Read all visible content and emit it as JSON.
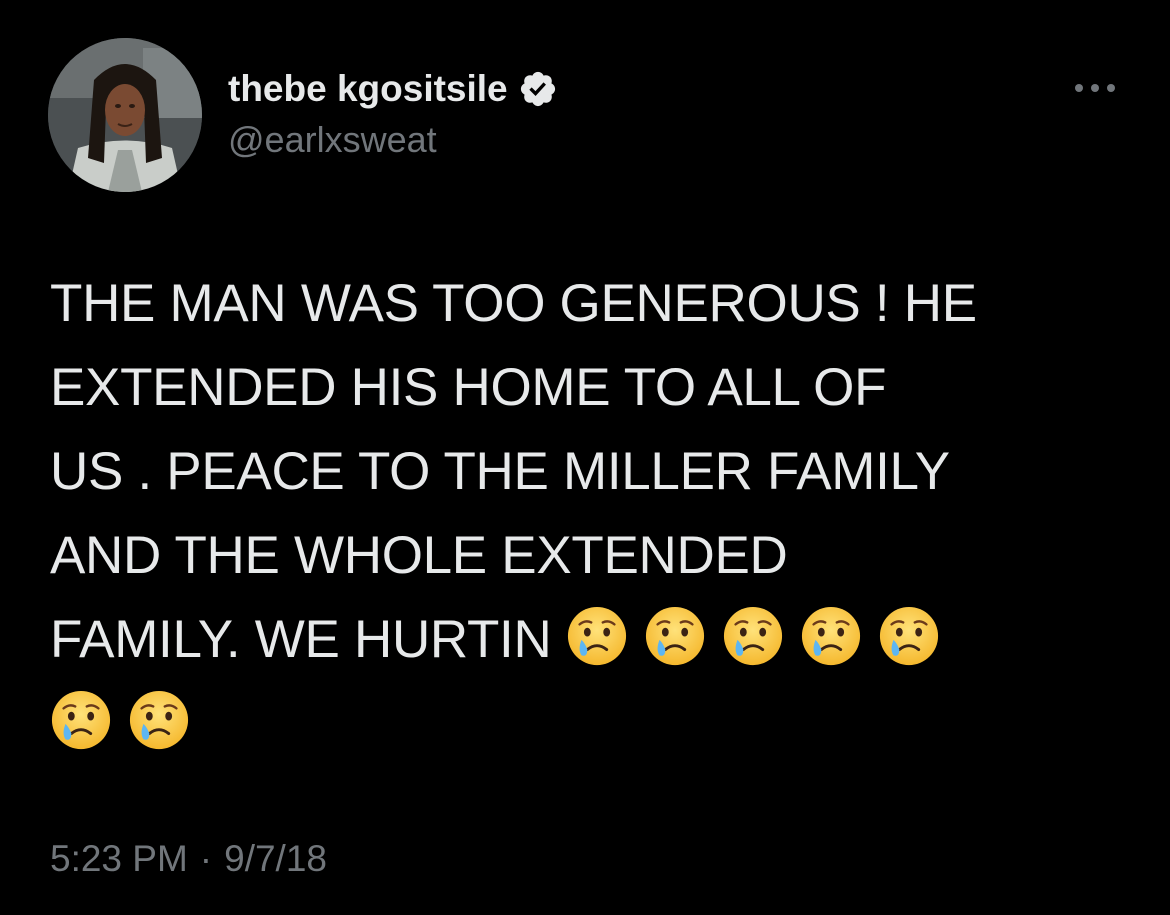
{
  "user": {
    "display_name": "thebe kgositsile",
    "handle": "@earlxsweat",
    "verified": true,
    "verified_badge_color": "#e7e9ea"
  },
  "tweet": {
    "line1": "THE MAN WAS TOO GENEROUS ! HE",
    "line2": "EXTENDED HIS HOME TO ALL OF",
    "line3": "US . PEACE TO THE MILLER FAMILY",
    "line4": "AND THE WHOLE EXTENDED",
    "line5": "FAMILY. WE HURTIN",
    "emoji": "crying-face-emoji",
    "emoji_count": 7
  },
  "meta": {
    "time": "5:23 PM",
    "separator": "·",
    "date": "9/7/18"
  },
  "icons": {
    "more": "more-options-icon",
    "verified": "verified-badge-icon"
  },
  "colors": {
    "background": "#000000",
    "text": "#e7e9ea",
    "secondary": "#71767b"
  }
}
